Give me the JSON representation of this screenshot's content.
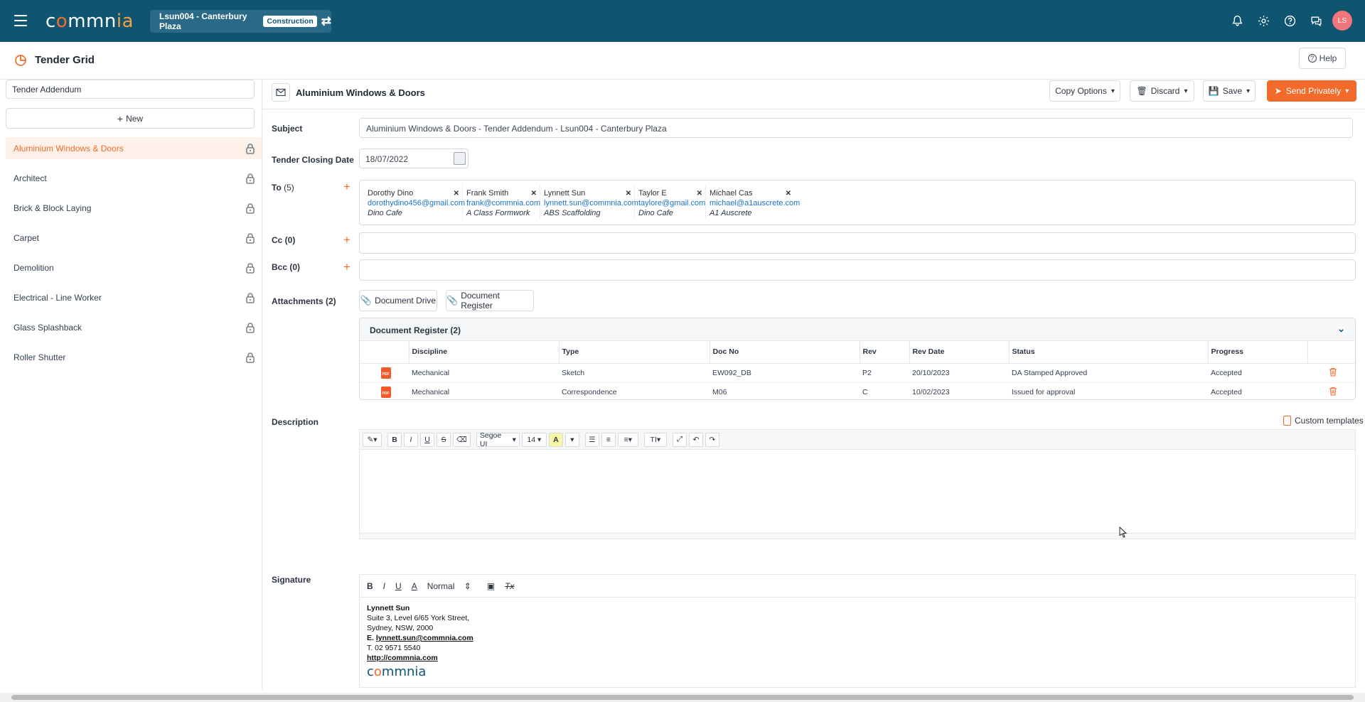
{
  "topbar": {
    "logo": {
      "c": "c",
      "o": "o",
      "mmn": "mmn",
      "ia": "ia"
    },
    "project": "Lsun004 - Canterbury Plaza",
    "project_badge": "Construction",
    "avatar_initials": "LS",
    "icons": [
      "bell-icon",
      "gear-icon",
      "help-icon",
      "chat-icon"
    ]
  },
  "page": {
    "title": "Tender Grid",
    "help_label": "Help"
  },
  "sidebar": {
    "select_value": "Tender Addendum",
    "new_label": "New",
    "items": [
      {
        "label": "Aluminium Windows & Doors",
        "active": true
      },
      {
        "label": "Architect"
      },
      {
        "label": "Brick & Block Laying"
      },
      {
        "label": "Carpet"
      },
      {
        "label": "Demolition"
      },
      {
        "label": "Electrical - Line Worker"
      },
      {
        "label": "Glass Splashback"
      },
      {
        "label": "Roller Shutter"
      }
    ]
  },
  "main": {
    "title": "Aluminium Windows & Doors",
    "buttons": {
      "copy_options": "Copy Options",
      "discard": "Discard",
      "save": "Save",
      "send": "Send Privately"
    },
    "labels": {
      "subject": "Subject",
      "closing_date": "Tender Closing Date",
      "to": "To",
      "to_count": "(5)",
      "cc": "Cc (0)",
      "bcc": "Bcc (0)",
      "attachments": "Attachments (2)",
      "description": "Description",
      "signature": "Signature"
    },
    "subject_value": "Aluminium Windows & Doors - Tender Addendum - Lsun004 - Canterbury Plaza",
    "closing_date_value": "18/07/2022",
    "recipients": [
      {
        "name": "Dorothy Dino",
        "email": "dorothydino456@gmail.com",
        "company": "Dino Cafe"
      },
      {
        "name": "Frank Smith",
        "email": "frank@commnia.com",
        "company": "A Class Formwork"
      },
      {
        "name": "Lynnett Sun",
        "email": "lynnett.sun@commnia.com",
        "company": "ABS Scaffolding"
      },
      {
        "name": "Taylor E",
        "email": "taylore@gmail.com",
        "company": "Dino Cafe"
      },
      {
        "name": "Michael Cas",
        "email": "michael@a1auscrete.com",
        "company": "A1 Auscrete"
      }
    ],
    "attach_buttons": {
      "drive": "Document Drive",
      "register": "Document Register"
    },
    "doc_register": {
      "title": "Document Register (2)",
      "columns": [
        "Discipline",
        "Type",
        "Doc No",
        "Rev",
        "Rev Date",
        "Status",
        "Progress"
      ],
      "rows": [
        {
          "discipline": "Mechanical",
          "type": "Sketch",
          "doc_no": "EW092_DB",
          "rev": "P2",
          "rev_date": "20/10/2023",
          "status": "DA Stamped Approved",
          "progress": "Accepted"
        },
        {
          "discipline": "Mechanical",
          "type": "Correspondence",
          "doc_no": "M06",
          "rev": "C",
          "rev_date": "10/02/2023",
          "status": "Issued for approval",
          "progress": "Accepted"
        }
      ],
      "pdf_label": "PDF"
    },
    "custom_templates": "Custom templates",
    "toolbar": {
      "font": "Segoe UI",
      "size": "14",
      "highlight": "A",
      "bold": "B",
      "italic": "I",
      "underline": "U",
      "strike": "S",
      "text_style": "TI"
    },
    "sig_toolbar": {
      "bold": "B",
      "italic": "I",
      "underline": "U",
      "color": "A",
      "format": "Normal",
      "clear": "Tx"
    },
    "signature": {
      "name": "Lynnett Sun",
      "address1": "Suite 3, Level 6/65 York Street,",
      "address2": "Sydney, NSW, 2000",
      "email_prefix": "E.",
      "email": "lynnett.sun@commnia.com",
      "phone": "T. 02 9571 5540",
      "website": "http://commnia.com",
      "logo": {
        "c": "c",
        "o": "o",
        "mmnia": "mmnia"
      }
    }
  },
  "colors": {
    "topbar": "#0f5572",
    "accent": "#f26b2a",
    "link": "#1a74c8"
  }
}
